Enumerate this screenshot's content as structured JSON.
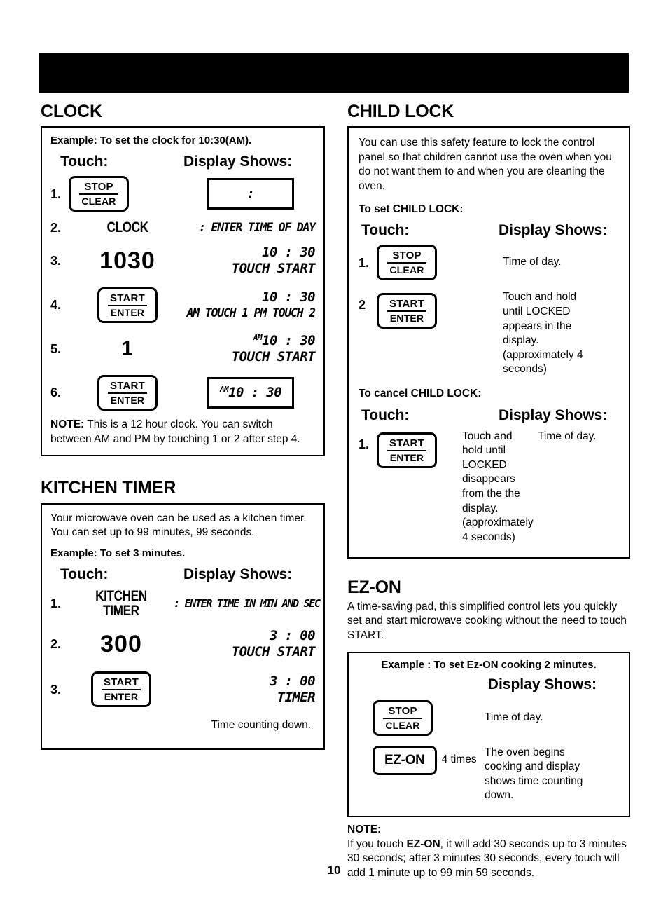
{
  "page": {
    "number": "10",
    "header_bar_color": "#000000"
  },
  "clock": {
    "title": "CLOCK",
    "example": "Example: To set the clock for 10:30(AM).",
    "touch_header": "Touch:",
    "display_header": "Display Shows:",
    "steps": [
      {
        "num": "1.",
        "key_top": "STOP",
        "key_bottom": "CLEAR",
        "display_boxed": ":"
      },
      {
        "num": "2.",
        "pad_label": "CLOCK",
        "display_line1": ": ENTER TIME OF DAY"
      },
      {
        "num": "3.",
        "pad_number": "1030",
        "display_line1": "10 : 30",
        "display_line2": "TOUCH START"
      },
      {
        "num": "4.",
        "key_top": "START",
        "key_bottom": "ENTER",
        "display_line1": "10 : 30",
        "display_line2": "AM TOUCH 1 PM TOUCH 2"
      },
      {
        "num": "5.",
        "pad_number": "1",
        "display_ampm": "AM",
        "display_line1": "10 : 30",
        "display_line2": "TOUCH START"
      },
      {
        "num": "6.",
        "key_top": "START",
        "key_bottom": "ENTER",
        "display_boxed_ampm": "AM",
        "display_boxed": "10 : 30"
      }
    ],
    "note_label": "NOTE:",
    "note_text": " This is a 12 hour clock. You can switch between AM and PM by touching 1 or 2 after step 4."
  },
  "kitchen_timer": {
    "title": "KITCHEN TIMER",
    "intro": "Your microwave oven can be used as a kitchen timer. You can set up to 99 minutes, 99 seconds.",
    "example": "Example: To set 3 minutes.",
    "touch_header": "Touch:",
    "display_header": "Display Shows:",
    "steps": [
      {
        "num": "1.",
        "pad_label_line1": "KITCHEN",
        "pad_label_line2": "TIMER",
        "display_line1": ": ENTER TIME IN MIN AND SEC"
      },
      {
        "num": "2.",
        "pad_number": "300",
        "display_line1": "3 : 00",
        "display_line2": "TOUCH START"
      },
      {
        "num": "3.",
        "key_top": "START",
        "key_bottom": "ENTER",
        "display_line1": "3 : 00",
        "display_line2": "TIMER"
      }
    ],
    "footer_note": "Time counting down."
  },
  "child_lock": {
    "title": "CHILD LOCK",
    "intro": "You can use this safety feature to lock the control panel so that children cannot use the oven when you do not want them to and when you are cleaning the oven.",
    "set_heading": "To set CHILD LOCK:",
    "touch_header": "Touch:",
    "display_header": "Display Shows:",
    "set_steps": [
      {
        "num": "1.",
        "key_top": "STOP",
        "key_bottom": "CLEAR",
        "display_text": "Time of day."
      },
      {
        "num": "2",
        "key_top": "START",
        "key_bottom": "ENTER",
        "display_text": "Touch and hold until LOCKED appears in the display. (approximately 4 seconds)"
      }
    ],
    "cancel_heading": "To cancel CHILD LOCK:",
    "cancel_touch_header": "Touch:",
    "cancel_display_header": "Display Shows:",
    "cancel_steps": [
      {
        "num": "1.",
        "key_top": "START",
        "key_bottom": "ENTER",
        "middle_text": "Touch and hold until LOCKED disappears from the the display. (approximately 4 seconds)",
        "display_text": "Time of day."
      }
    ]
  },
  "ez_on": {
    "title": "EZ-ON",
    "intro": "A time-saving pad, this simplified control lets you quickly set and start microwave cooking without the need to touch START.",
    "example": "Example : To set Ez-ON cooking 2 minutes.",
    "display_header": "Display Shows:",
    "steps": [
      {
        "key_top": "STOP",
        "key_bottom": "CLEAR",
        "display_text": "Time of day."
      },
      {
        "pad_single": "EZ-ON",
        "suffix": "4 times",
        "display_text": "The oven begins cooking and display shows time counting down."
      }
    ],
    "note_label": "NOTE:",
    "note_part1": "If you touch ",
    "note_bold": "EZ-ON",
    "note_part2": ", it will add 30 seconds up to 3 minutes 30 seconds; after 3 minutes 30 seconds, every touch will add 1 minute up to 99 min 59 seconds."
  }
}
